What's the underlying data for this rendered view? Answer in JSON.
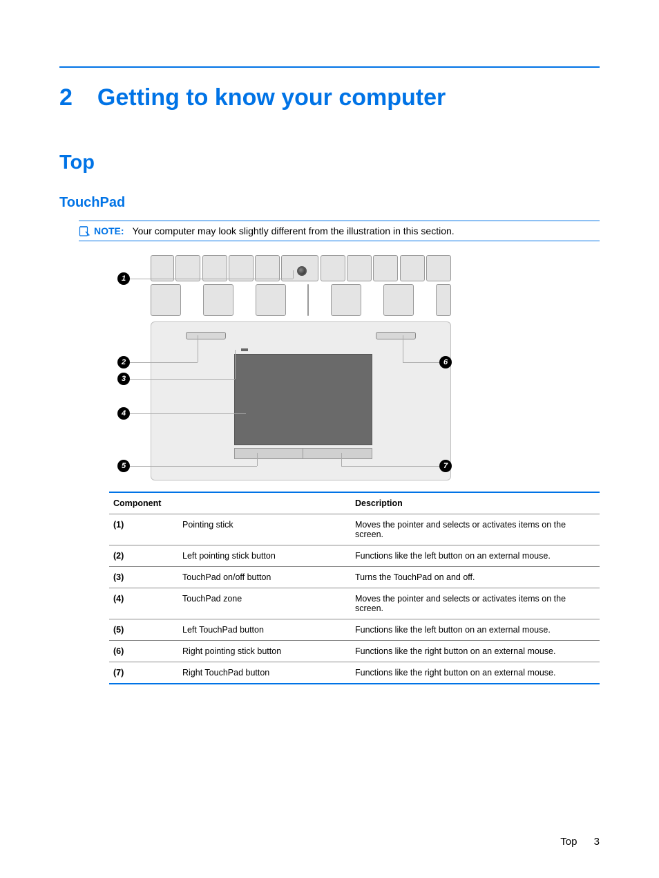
{
  "chapter": {
    "number": "2",
    "title": "Getting to know your computer"
  },
  "section": "Top",
  "subsection": "TouchPad",
  "note": {
    "label": "NOTE:",
    "text": "Your computer may look slightly different from the illustration in this section."
  },
  "callouts": {
    "c1": "1",
    "c2": "2",
    "c3": "3",
    "c4": "4",
    "c5": "5",
    "c6": "6",
    "c7": "7"
  },
  "table": {
    "headers": {
      "component": "Component",
      "description": "Description"
    },
    "rows": [
      {
        "num": "(1)",
        "component": "Pointing stick",
        "description": "Moves the pointer and selects or activates items on the screen."
      },
      {
        "num": "(2)",
        "component": "Left pointing stick button",
        "description": "Functions like the left button on an external mouse."
      },
      {
        "num": "(3)",
        "component": "TouchPad on/off button",
        "description": "Turns the TouchPad on and off."
      },
      {
        "num": "(4)",
        "component": "TouchPad zone",
        "description": "Moves the pointer and selects or activates items on the screen."
      },
      {
        "num": "(5)",
        "component": "Left TouchPad button",
        "description": "Functions like the left button on an external mouse."
      },
      {
        "num": "(6)",
        "component": "Right pointing stick button",
        "description": "Functions like the right button on an external mouse."
      },
      {
        "num": "(7)",
        "component": "Right TouchPad button",
        "description": "Functions like the right button on an external mouse."
      }
    ]
  },
  "footer": {
    "label": "Top",
    "page": "3"
  }
}
